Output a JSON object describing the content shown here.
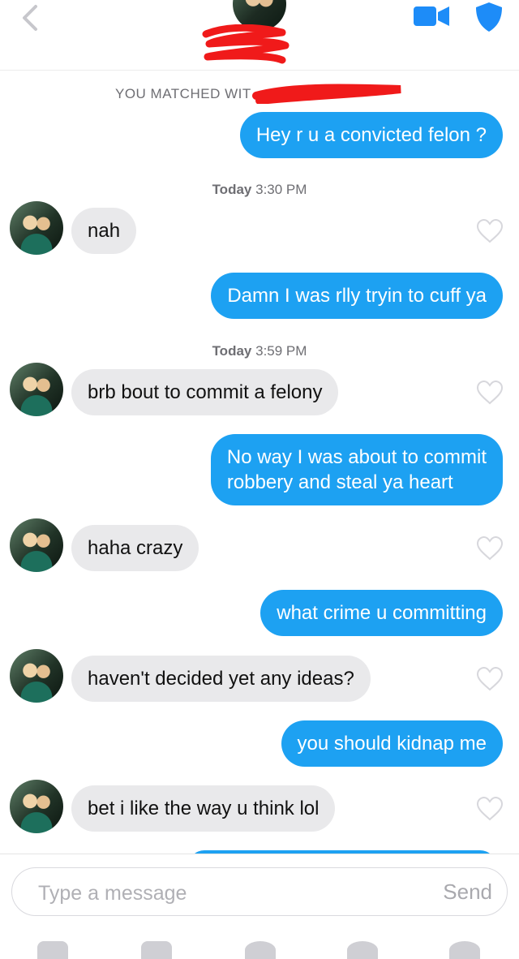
{
  "header": {
    "back_icon": "chevron-left-icon",
    "video_icon": "video-call-icon",
    "safety_icon": "shield-icon",
    "accent_color": "#1d8cf8"
  },
  "chat": {
    "matched_text": "YOU MATCHED WIT",
    "messages": [
      {
        "type": "sent",
        "text": "Hey r u a convicted felon ?"
      },
      {
        "type": "timestamp",
        "day": "Today",
        "time": "3:30 PM"
      },
      {
        "type": "received",
        "text": "nah"
      },
      {
        "type": "sent",
        "text": "Damn I was rlly tryin to cuff ya"
      },
      {
        "type": "timestamp",
        "day": "Today",
        "time": "3:59 PM"
      },
      {
        "type": "received",
        "text": "brb bout to commit a felony"
      },
      {
        "type": "sent",
        "lines": [
          "No way I was about to commit",
          "robbery and steal ya heart"
        ]
      },
      {
        "type": "received",
        "text": "haha crazy"
      },
      {
        "type": "sent",
        "text": "what crime u committing"
      },
      {
        "type": "received",
        "text": "haven't decided yet any ideas?"
      },
      {
        "type": "sent",
        "text": "you should kidnap me"
      },
      {
        "type": "received",
        "text": "bet i like the way u think lol"
      }
    ],
    "sent_color": "#1da1f2",
    "received_color": "#e9e9eb"
  },
  "composer": {
    "placeholder": "Type a message",
    "send_label": "Send"
  }
}
